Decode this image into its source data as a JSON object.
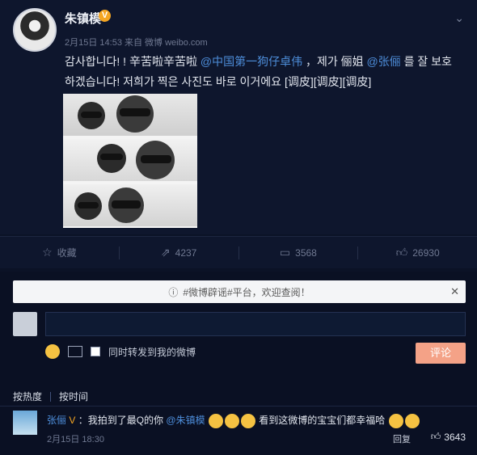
{
  "post": {
    "username": "朱镇模",
    "verified": "V",
    "meta": "2月15日 14:53 来自 微博 weibo.com",
    "text_line1_prefix": "감사합니다! ! 辛苦啦辛苦啦 ",
    "mention1": "@中国第一狗仔卓伟",
    "text_line1_mid": "，제가 俪姐 ",
    "mention2": "@张俪",
    "text_line1_suffix": " 를 잘 보호",
    "text_line2": "하겠습니다! 저희가 찍은 사진도 바로 이거에요 [调皮][调皮][调皮]"
  },
  "actions": {
    "collect": "收藏",
    "forward": "4237",
    "comment": "3568",
    "like": "26930"
  },
  "comments_section": {
    "notice": "#微博辟谣#平台，欢迎查阅！",
    "forward_checkbox_label": "同时转发到我的微博",
    "submit": "评论",
    "sort_hot": "按热度",
    "sort_time": "按时间"
  },
  "comment": {
    "username": "张俪",
    "badges": "V",
    "text_prefix": "：我拍到了最Q的你",
    "mention": "@朱镇模",
    "text_mid": "看到这微博的宝宝们都幸福哈",
    "time": "2月15日 18:30",
    "reply": "回复",
    "likes": "3643"
  },
  "icons": {
    "close": "close-icon",
    "chevron": "chevron-down-icon",
    "info": "info-icon"
  }
}
